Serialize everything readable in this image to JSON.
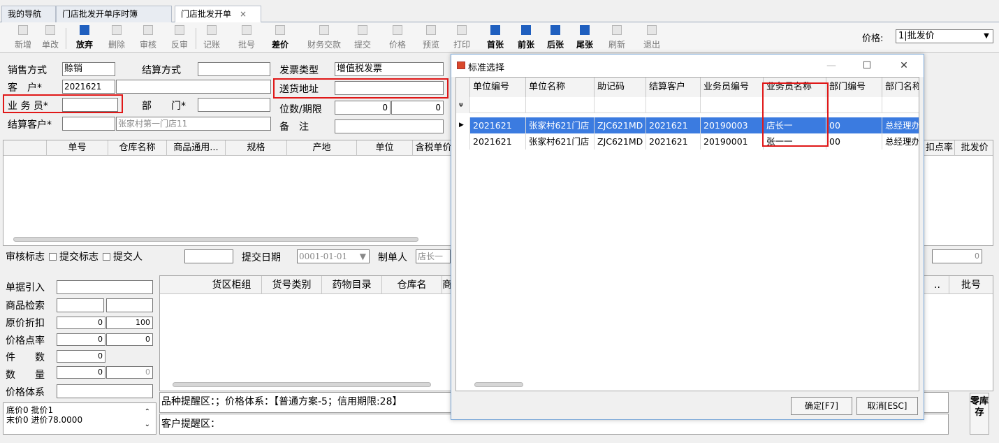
{
  "tabs": [
    "我的导航",
    "门店批发开单序时簿",
    "门店批发开单"
  ],
  "tab_close": "×",
  "toolbar": {
    "buttons": [
      "新增",
      "单改",
      "放弃",
      "删除",
      "审核",
      "反审",
      "记账",
      "批号",
      "差价",
      "财务交款",
      "提交",
      "价格",
      "预览",
      "打印",
      "首张",
      "前张",
      "后张",
      "尾张",
      "刷新",
      "退出"
    ],
    "price_label": "价格:",
    "price_value": "1|批发价",
    "dropdown_arrow": "▼"
  },
  "form": {
    "sale_mode_label": "销售方式",
    "sale_mode_value": "赊销",
    "settle_mode_label": "结算方式",
    "invoice_type_label": "发票类型",
    "invoice_type_value": "增值税发票",
    "customer_label": "客　户*",
    "customer_value": "2021621",
    "delivery_label": "送货地址",
    "salesman_label": "业 务 员*",
    "dept_label": "部　　门*",
    "digits_label": "位数/期限",
    "digits_value": "0",
    "digits_value2": "0",
    "settle_customer_label": "结算客户*",
    "settle_customer_name": "张家村第一门店11",
    "remark_label": "备　注"
  },
  "main_grid": {
    "columns": [
      "单号",
      "仓库名称",
      "商品通用...",
      "规格",
      "产地",
      "单位",
      "含税单价",
      "扣点率",
      "批发价"
    ]
  },
  "status_bar": {
    "audit_label": "审核标志",
    "submit_flag_label": "提交标志",
    "submitter_label": "提交人",
    "submit_date_label": "提交日期",
    "submit_date_value": "0001-01-01",
    "maker_label": "制单人",
    "maker_value": "店长一",
    "right_value": "0"
  },
  "left_panel": {
    "doc_import_label": "单据引入",
    "goods_search_label": "商品检索",
    "discount_label": "原价折扣",
    "discount_v1": "0",
    "discount_v2": "100",
    "point_label": "价格点率",
    "point_v1": "0",
    "point_v2": "0",
    "pieces_label": "件　　数",
    "pieces_v1": "0",
    "qty_label": "数　　量",
    "qty_v1": "0",
    "qty_v2": "0",
    "price_system_label": "价格体系",
    "info_line1": "底价0 批价1",
    "info_line2": "末价0 进价78.0000"
  },
  "lower_grid": {
    "columns": [
      "货区柜组",
      "货号类别",
      "药物目录",
      "仓库名",
      "商",
      "..",
      "批号"
    ]
  },
  "reminders": {
    "goods": "品种提醒区：；价格体系：【普通方案-5；信用期限:28】",
    "customer": "客户提醒区："
  },
  "side_button": "零库存",
  "dialog": {
    "title": "标准选择",
    "win_min": "—",
    "win_max": "☐",
    "win_close": "✕",
    "columns": [
      "单位编号",
      "单位名称",
      "助记码",
      "结算客户",
      "业务员编号",
      "业务员名称",
      "部门编号",
      "部门名称"
    ],
    "filter_icon": "ᴪ",
    "rows": [
      [
        "2021621",
        "张家村621门店",
        "ZJC621MD",
        "2021621",
        "20190003",
        "店长一",
        "00",
        "总经理办"
      ],
      [
        "2021621",
        "张家村621门店",
        "ZJC621MD",
        "2021621",
        "20190001",
        "张一一",
        "00",
        "总经理办"
      ]
    ],
    "ok_label": "确定[F7]",
    "cancel_label": "取消[ESC]"
  }
}
